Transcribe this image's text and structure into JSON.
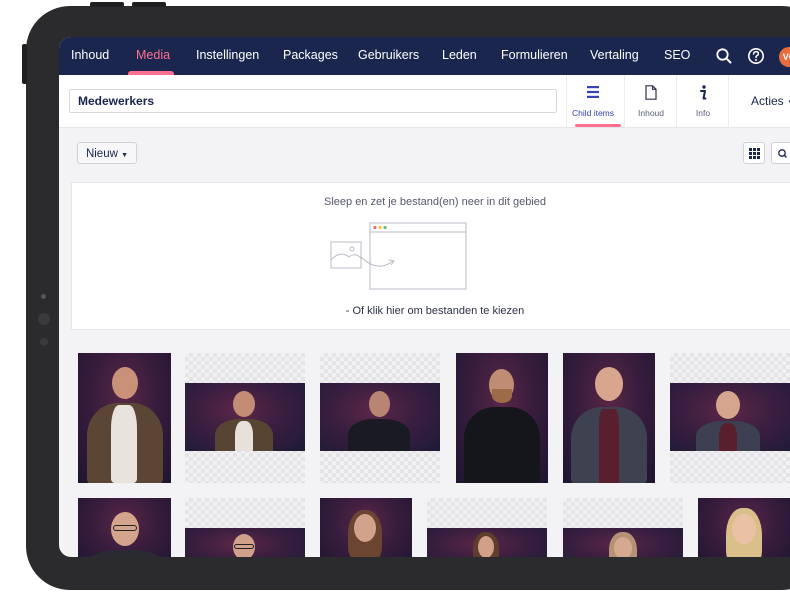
{
  "nav": {
    "items": [
      "Inhoud",
      "Media",
      "Instellingen",
      "Packages",
      "Gebruikers",
      "Leden",
      "Formulieren",
      "Vertaling",
      "SEO"
    ],
    "active_index": 1,
    "avatar_initials": "VC"
  },
  "header": {
    "node_name": "Medewerkers",
    "apps": [
      {
        "label": "Child items",
        "icon": "list-icon",
        "active": true
      },
      {
        "label": "Inhoud",
        "icon": "document-icon",
        "active": false
      },
      {
        "label": "Info",
        "icon": "info-icon",
        "active": false
      }
    ],
    "actions_label": "Acties"
  },
  "toolbar": {
    "new_label": "Nieuw"
  },
  "dropzone": {
    "title": "Sleep en zet je bestand(en) neer in dit gebied",
    "subtitle": "- Of klik hier om bestanden te kiezen"
  },
  "colors": {
    "nav_bg": "#1b264f",
    "accent": "#ff6f8f",
    "active_app": "#3544b1",
    "avatar": "#e76d3c"
  }
}
